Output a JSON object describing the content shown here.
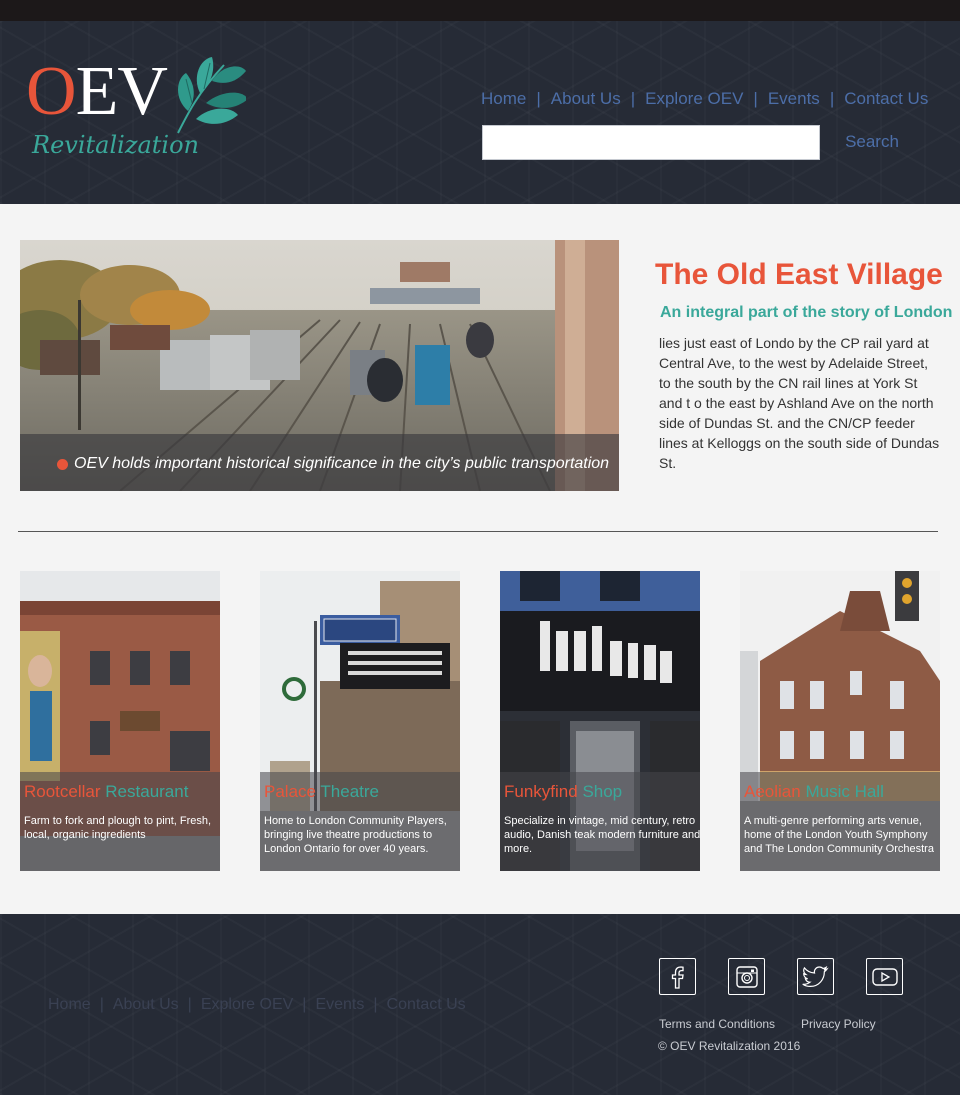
{
  "header": {
    "logo": {
      "main": "OEV",
      "sub": "Revitalization"
    },
    "nav": [
      "Home",
      "About Us",
      "Explore OEV",
      "Events",
      "Contact Us"
    ],
    "nav_separator": "|",
    "search": {
      "placeholder": "",
      "button_label": "Search"
    }
  },
  "hero": {
    "caption": "OEV holds important historical significance in the city’s public transportation"
  },
  "intro": {
    "title": "The Old East Village",
    "subtitle": "An integral part of the story of London",
    "body": "lies just east of Londo  by the CP rail yard at Central Ave, to the west by Adelaide Street, to the south by the CN rail lines at York St and t o the east by Ashland Ave on the north side of Dundas St. and the CN/CP feeder lines at Kelloggs on the south side of Dundas St."
  },
  "cards": [
    {
      "title_a": "Rootcellar",
      "title_b": "Restaurant",
      "desc": "Farm to fork and plough to pint, Fresh, local, organic ingredients"
    },
    {
      "title_a": "Palace",
      "title_b": "Theatre",
      "desc": "Home to London Community Players, bringing live theatre productions to London Ontario for over 40 years."
    },
    {
      "title_a": "Funkyfind",
      "title_b": "Shop",
      "desc": "Specialize in vintage, mid century, retro audio, Danish teak modern furniture and more."
    },
    {
      "title_a": "Aeolian",
      "title_b": "Music Hall",
      "desc": "A multi-genre performing arts venue, home of the London Youth Symphony and The London Community Orchestra"
    }
  ],
  "footer": {
    "nav": [
      "Home",
      "About Us",
      "Explore OEV",
      "Events",
      "Contact Us"
    ],
    "nav_separator": "|",
    "social": [
      "facebook-icon",
      "instagram-icon",
      "twitter-icon",
      "youtube-icon"
    ],
    "links": [
      "Terms and Conditions",
      "Privacy Policy"
    ],
    "copyright": "© OEV Revitalization 2016"
  },
  "colors": {
    "accent_red": "#e8553a",
    "accent_teal": "#3aa89a",
    "nav_blue": "#4c6ea8",
    "header_bg": "#262b36"
  }
}
